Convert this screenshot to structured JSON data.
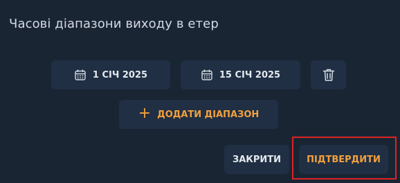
{
  "dialog": {
    "title": "Часові діапазони виходу в етер"
  },
  "range": {
    "start_date": "1 СІЧ 2025",
    "end_date": "15 СІЧ 2025",
    "calendar_icon": "calendar-icon",
    "delete_icon": "trash-icon"
  },
  "actions": {
    "add_range_label": "ДОДАТИ ДІАПАЗОН",
    "add_icon": "plus-icon",
    "close_label": "ЗАКРИТИ",
    "confirm_label": "ПІДТВЕРДИТИ"
  },
  "colors": {
    "background": "#1a2534",
    "button_bg": "#202f43",
    "accent": "#f3a13e",
    "highlight": "#e02323"
  }
}
